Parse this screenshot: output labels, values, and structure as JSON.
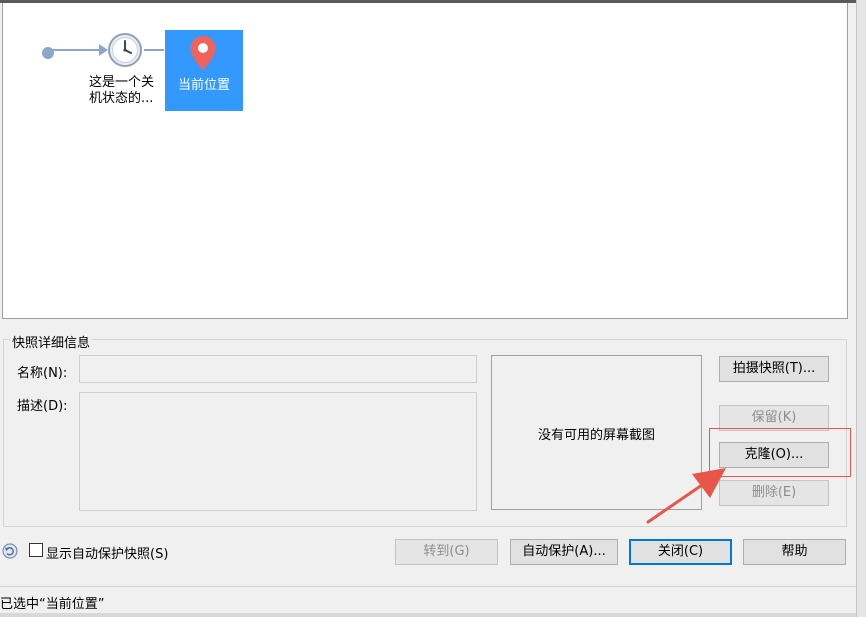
{
  "tree": {
    "snapshot_label": "这是一个关机状态的...",
    "current_label": "当前位置"
  },
  "details": {
    "group_title": "快照详细信息",
    "name_label": "名称(N):",
    "name_value": "",
    "description_label": "描述(D):",
    "description_value": "",
    "screenshot_placeholder": "没有可用的屏幕截图"
  },
  "side_buttons": {
    "take_snapshot": "拍摄快照(T)...",
    "keep": "保留(K)",
    "clone": "克隆(O)...",
    "delete": "删除(E)"
  },
  "footer": {
    "show_autoprotect_label": "显示自动保护快照(S)",
    "show_autoprotect_checked": false,
    "goto": "转到(G)",
    "autoprotect": "自动保护(A)...",
    "close": "关闭(C)",
    "help": "帮助"
  },
  "status": {
    "text": "已选中“当前位置”"
  },
  "colors": {
    "selection": "#3399ff",
    "annotation": "#e8554a",
    "pin": "#f0625a"
  },
  "icons": [
    "clock-icon",
    "location-pin-icon",
    "autoprotect-icon",
    "annotation-arrow"
  ]
}
